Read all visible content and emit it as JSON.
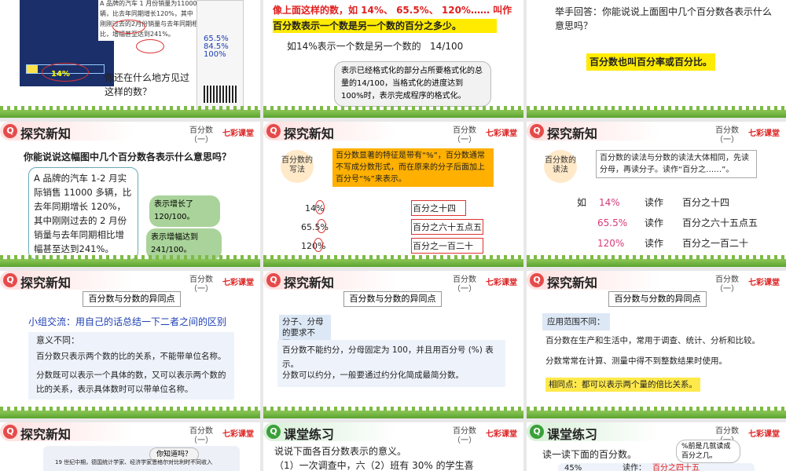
{
  "header_common": {
    "unit_title": "百分数",
    "unit_sub": "（一）",
    "brand": "七彩课堂"
  },
  "s1": {
    "car_text": "A 品牌的汽车 1 月份销量为11000辆，比去年同期增长120%，其中刚刚过去的2月份销量与去年同期相比，增幅甚至达到241%。",
    "blue_pct": "120%",
    "blue_pct2": "241%",
    "progress_pct": "14%",
    "label_pcts": [
      "65.5%",
      "84.5%",
      "100%"
    ],
    "question": "你还在什么地方见过这样的数？"
  },
  "s2": {
    "line1": "像上面这样的数，如 14%、 65.5%、 120%…… 叫作百分数。",
    "hl": "百分数表示一个数是另一个数的百分之多少。",
    "line3": "如14%表示一个数是另一个数的",
    "frac": "14/100",
    "bubble": "表示已经格式化的部分占所要格式化的总量的14/100，当格式化的进度达到100%时，表示完成程序的格式化。"
  },
  "s3": {
    "q": "举手回答：你能说说上面图中几个百分数各表示什么意思吗？",
    "hl": "百分数也叫百分率或百分比。"
  },
  "s4": {
    "title": "探究新知",
    "q": "你能说说这幅图中几个百分数各表示什么意思吗？",
    "para": "A 品牌的汽车 1-2 月实际销售 11000 多辆，比去年同期增长 120%，其中刚刚过去的 2 月份销量与去年同期相比增幅甚至达到241%。",
    "b1": "表示增长了120/100。",
    "b2": "表示增幅达到241/100。"
  },
  "s5": {
    "title": "探究新知",
    "leaf": "百分数的写法",
    "info": "百分数显著的特征是带有“%”，百分数通常不写成分数形式，而在原来的分子后面加上百分号“%”来表示。",
    "items": [
      [
        "14%",
        "百分之十四"
      ],
      [
        "65.5%",
        "百分之六十五点五"
      ],
      [
        "120%",
        "百分之一百二十"
      ]
    ]
  },
  "s6": {
    "title": "探究新知",
    "leaf": "百分数的读法",
    "info": "百分数的读法与分数的读法大体相同，先读分母，再读分子。读作“百分之……”。",
    "rows": [
      [
        "如",
        "14%",
        "读作",
        "百分之十四"
      ],
      [
        "",
        "65.5%",
        "读作",
        "百分之六十五点五"
      ],
      [
        "",
        "120%",
        "读作",
        "百分之一百二十"
      ]
    ]
  },
  "s7": {
    "title": "探究新知",
    "box": "百分数与分数的异同点",
    "small": "小组交流：用自己的话总结一下二者之间的区别",
    "sub": "意义不同：",
    "p1": "百分数只表示两个数的比的关系，不能带单位名称。",
    "p2": "分数既可以表示一个具体的数，又可以表示两个数的比的关系，表示具体数时可以带单位名称。"
  },
  "s8": {
    "title": "探究新知",
    "box": "百分数与分数的异同点",
    "sub": "分子、分母的要求不同：",
    "p1": "百分数不能约分，分母固定为 100，并且用百分号 (%) 表示。",
    "p2": "分数可以约分，一般要通过约分化简成最简分数。"
  },
  "s9": {
    "title": "探究新知",
    "box": "百分数与分数的异同点",
    "sub": "应用范围不同：",
    "p1": "百分数在生产和生活中，常用于调查、统计、分析和比较。",
    "p2": "分数常常在计算、测量中得不到整数结果时使用。",
    "p3": "相同点：都可以表示两个量的倍比关系。"
  },
  "s10": {
    "title": "探究新知",
    "bubble": "你知道吗？",
    "text": "19 世纪中期，德国统计学家、经济学家恩格尔对比利时不同收入"
  },
  "s11": {
    "title": "课堂练习",
    "q": "说说下面各百分数表示的意义。",
    "p1": "（1）一次调查中，六（2）班有 30% 的学生喜"
  },
  "s12": {
    "title": "课堂练习",
    "q": "读一读下面的百分数。",
    "note": "%前是几就读成百分之几。",
    "row": [
      "45%",
      "读作：",
      "百分之四十五"
    ]
  }
}
